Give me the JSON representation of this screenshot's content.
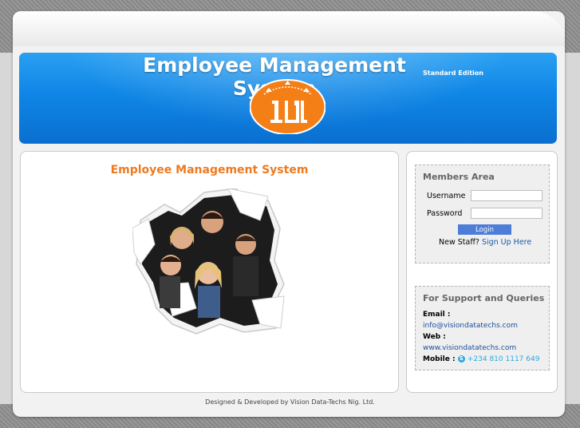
{
  "header": {
    "title": "Employee Management System",
    "edition": "Standard Edition"
  },
  "main": {
    "heading": "Employee Management System"
  },
  "members_area": {
    "title": "Members Area",
    "username_label": "Username",
    "password_label": "Password",
    "username_value": "",
    "password_value": "",
    "login_label": "Login",
    "new_staff_text": "New Staff?",
    "signup_link": "Sign Up Here"
  },
  "support": {
    "title": "For Support and Queries",
    "email_label": "Email :",
    "email": "info@visiondatatechs.com",
    "web_label": "Web :",
    "web": "www.visiondatatechs.com",
    "mobile_label": "Mobile :",
    "mobile": "+234 810 1117 649",
    "mobile_icon": "skype-icon"
  },
  "footer": {
    "text": "Designed & Developed by Vision Data-Techs Nig. Ltd."
  },
  "colors": {
    "banner": "#0f86e6",
    "heading": "#ee7a1f",
    "link": "#1a5aa5",
    "button": "#4d7dd8"
  }
}
